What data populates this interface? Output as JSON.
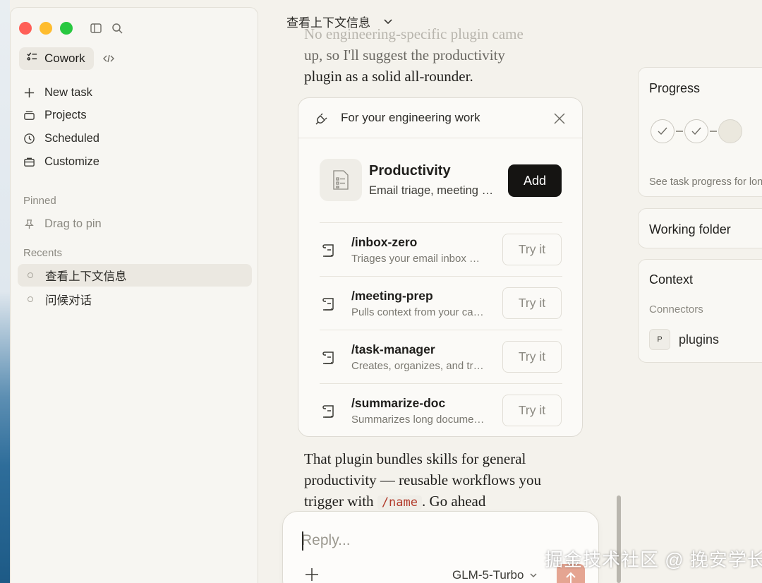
{
  "sidebar": {
    "mode_label": "Cowork",
    "nav": [
      {
        "label": "New task",
        "icon": "plus-icon"
      },
      {
        "label": "Projects",
        "icon": "folder-icon"
      },
      {
        "label": "Scheduled",
        "icon": "clock-icon"
      },
      {
        "label": "Customize",
        "icon": "briefcase-icon"
      }
    ],
    "pinned_label": "Pinned",
    "pin_hint": "Drag to pin",
    "recents_label": "Recents",
    "recents": [
      {
        "label": "查看上下文信息",
        "active": true
      },
      {
        "label": "问候对话",
        "active": false
      }
    ]
  },
  "main": {
    "chat_title": "查看上下文信息",
    "prose_top_ghost": "No engineering-specific plugin came",
    "prose_top_line2": "up, so I'll suggest the productivity",
    "prose_top_line3": "plugin as a solid all-rounder.",
    "prose_bottom_1": "That plugin bundles skills for general productivity — reusable workflows you trigger with",
    "prose_bottom_code": "/name",
    "prose_bottom_2": ". Go ahead"
  },
  "plugin_card": {
    "header": "For your engineering work",
    "plugin_name": "Productivity",
    "plugin_desc": "Email triage, meeting prep, task management",
    "add_label": "Add",
    "skills": [
      {
        "name": "/inbox-zero",
        "desc": "Triages your email inbox and drafts replies",
        "action": "Try it"
      },
      {
        "name": "/meeting-prep",
        "desc": "Pulls context from your calendar and notes",
        "action": "Try it"
      },
      {
        "name": "/task-manager",
        "desc": "Creates, organizes, and tracks your tasks",
        "action": "Try it"
      },
      {
        "name": "/summarize-doc",
        "desc": "Summarizes long documents into key points",
        "action": "Try it"
      }
    ]
  },
  "right_panel": {
    "progress_title": "Progress",
    "progress_steps_done": 2,
    "progress_steps_total": 3,
    "progress_note": "See task progress for long tasks.",
    "working_folder_title": "Working folder",
    "context_title": "Context",
    "connectors_label": "Connectors",
    "connector_badge": "P",
    "connector_name": "plugins"
  },
  "reply": {
    "placeholder": "Reply...",
    "model": "GLM-5-Turbo"
  },
  "watermark": "掘金技术社区 @ 挽安学长",
  "colors": {
    "accent_send": "#e5a592",
    "add_button": "#151412",
    "code_text": "#b23a2a"
  }
}
